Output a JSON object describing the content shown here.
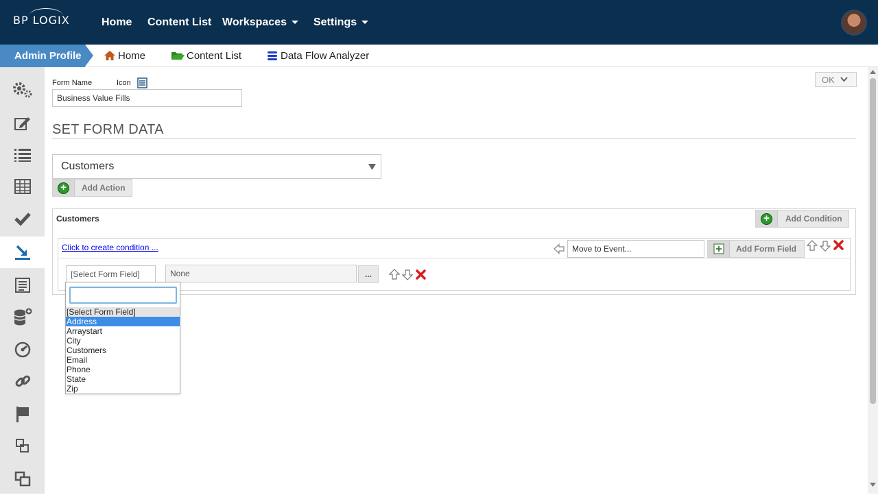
{
  "brand": {
    "logo_text": "BP LOGIX"
  },
  "topnav": {
    "home": "Home",
    "content_list": "Content List",
    "workspaces": "Workspaces",
    "settings": "Settings"
  },
  "breadcrumb": {
    "admin_profile": "Admin Profile",
    "home": "Home",
    "content_list": "Content List",
    "data_flow_analyzer": "Data Flow Analyzer"
  },
  "form": {
    "name_label": "Form Name",
    "icon_label": "Icon",
    "name_value": "Business Value Fills",
    "ok_label": "OK"
  },
  "section": {
    "title": "SET FORM DATA",
    "action_select_value": "Customers",
    "add_action_label": "Add Action"
  },
  "panel": {
    "title": "Customers",
    "add_condition_label": "Add Condition",
    "create_condition_link": "Click to create condition ...",
    "move_to_event_value": "Move to Event...",
    "add_form_field_label": "Add Form Field",
    "field_select_value": "[Select Form Field]",
    "value_input": "None",
    "ellipsis_button": "..."
  },
  "dropdown": {
    "search_value": "",
    "options": [
      "[Select Form Field]",
      "Address",
      "Arraystart",
      "City",
      "Customers",
      "Email",
      "Phone",
      "State",
      "Zip"
    ],
    "highlighted": "Address"
  },
  "colors": {
    "topnav_bg": "#0a2f4f",
    "breadcrumb_accent": "#4a8ac4",
    "sidebar_bg": "#e6e6e6",
    "highlight": "#3d8de6",
    "delete_red": "#d91c1c",
    "add_green": "#2a9a2a"
  },
  "sidebar_icons": [
    "gears-icon",
    "edit-icon",
    "list-icon",
    "table-icon",
    "check-icon",
    "import-icon",
    "report-icon",
    "database-add-icon",
    "speed-icon",
    "link-icon",
    "flag-icon",
    "window-icon",
    "windows-icon"
  ]
}
